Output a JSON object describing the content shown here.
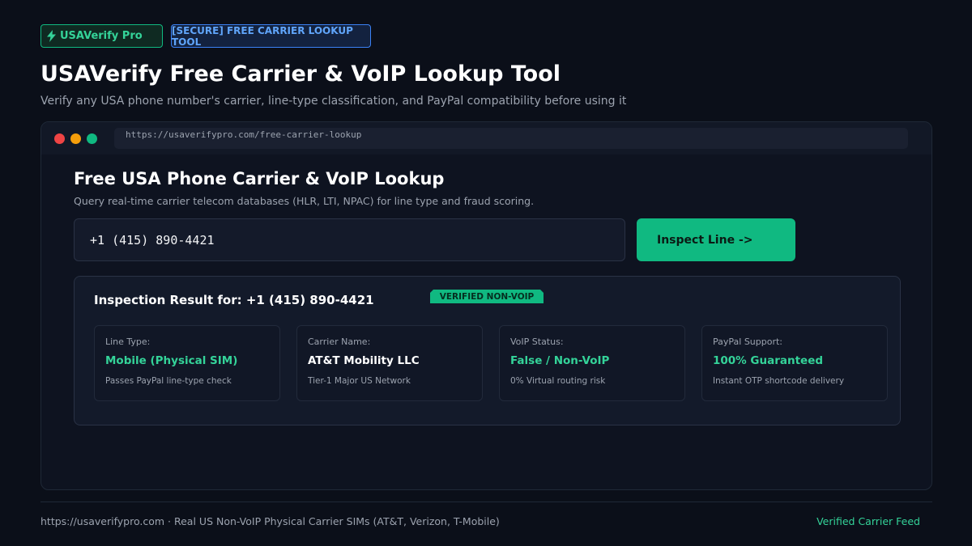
{
  "header": {
    "brand_badge": "USAVerify Pro",
    "secure_badge": "[SECURE] FREE CARRIER LOOKUP TOOL",
    "title": "USAVerify Free Carrier & VoIP Lookup Tool",
    "subtitle": "Verify any USA phone number's carrier, line-type classification, and PayPal compatibility before using it"
  },
  "browser": {
    "url": "https://usaverifypro.com/free-carrier-lookup"
  },
  "lookup": {
    "title": "Free USA Phone Carrier & VoIP Lookup",
    "description": "Query real-time carrier telecom databases (HLR, LTI, NPAC) for line type and fraud scoring.",
    "phone_value": "+1 (415) 890-4421",
    "button_label": "Inspect Line ->"
  },
  "result": {
    "title": "Inspection Result for: +1 (415) 890-4421",
    "badge": "VERIFIED NON-VOIP",
    "cards": [
      {
        "label": "Line Type:",
        "value": "Mobile (Physical SIM)",
        "note": "Passes PayPal line-type check"
      },
      {
        "label": "Carrier Name:",
        "value": "AT&T Mobility LLC",
        "note": "Tier-1 Major US Network"
      },
      {
        "label": "VoIP Status:",
        "value": "False / Non-VoIP",
        "note": "0% Virtual routing risk"
      },
      {
        "label": "PayPal Support:",
        "value": "100% Guaranteed",
        "note": "Instant OTP shortcode delivery"
      }
    ]
  },
  "footer": {
    "left": "https://usaverifypro.com · Real US Non-VoIP Physical Carrier SIMs (AT&T, Verizon, T-Mobile)",
    "right": "Verified Carrier Feed"
  },
  "colors": {
    "background": "#0b0f19",
    "accent_green": "#10b981",
    "accent_blue": "#3b82f6"
  },
  "icons": {
    "brand": "lightning-bolt-icon"
  }
}
